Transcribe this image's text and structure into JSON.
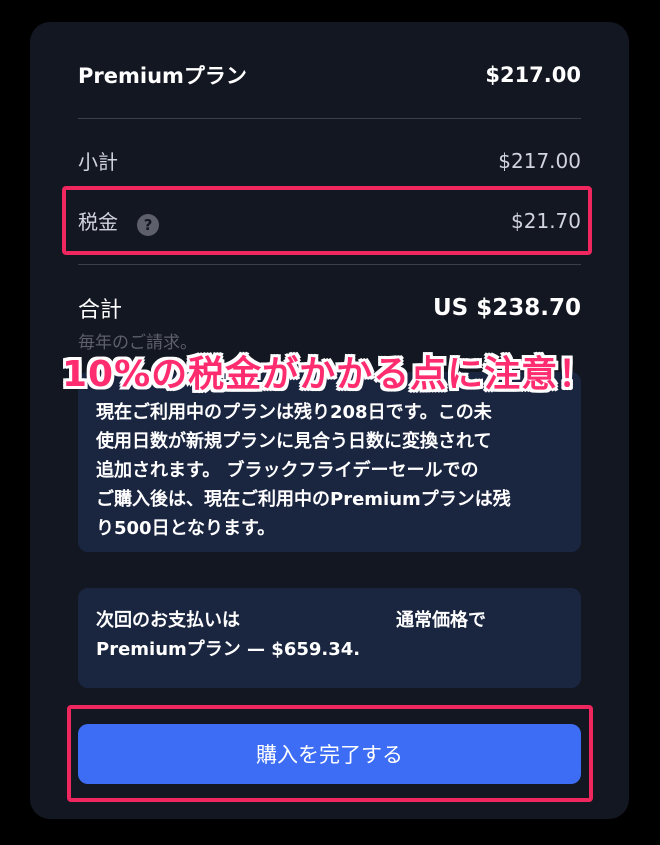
{
  "plan": {
    "name": "Premiumプラン",
    "price": "$217.00"
  },
  "subtotal": {
    "label": "小計",
    "value": "$217.00"
  },
  "tax": {
    "label": "税金",
    "help": "?",
    "value": "$21.70"
  },
  "total": {
    "label": "合計",
    "value": "US $238.70",
    "note": "毎年のご請求。"
  },
  "info_box": {
    "lines": [
      "現在ご利用中のプランは残り208日です。この未",
      "使用日数が新規プランに見合う日数に変換されて",
      "追加されます。 ブラックフライデーセールでの",
      "ご購入後は、現在ご利用中のPremiumプランは残",
      "り500日となります。"
    ]
  },
  "next_payment": {
    "line1_left": "次回のお支払いは",
    "line1_right": "通常価格で",
    "line2": "Premiumプラン — $659.34."
  },
  "buy_button": {
    "label": "購入を完了する"
  },
  "annotation": {
    "text": "10%の税金がかかる点に注意！"
  },
  "colors": {
    "card_bg": "#131722",
    "info_bg": "#1a2540",
    "button_bg": "#3d6df5",
    "highlight": "#f0265f",
    "annotation": "#ff2d6f"
  }
}
